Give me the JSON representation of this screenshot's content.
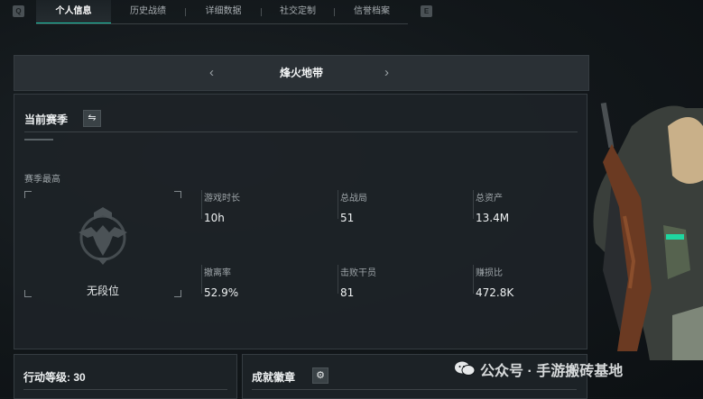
{
  "tabs": {
    "left_hint": "Q",
    "right_hint": "E",
    "items": [
      {
        "label": "个人信息",
        "active": true
      },
      {
        "label": "历史战绩",
        "active": false
      },
      {
        "label": "详细数据",
        "active": false
      },
      {
        "label": "社交定制",
        "active": false
      },
      {
        "label": "信誉档案",
        "active": false
      }
    ]
  },
  "mode": {
    "title": "烽火地带",
    "prev_icon": "chevron-left-icon",
    "next_icon": "chevron-right-icon"
  },
  "season": {
    "title": "当前赛季",
    "switch_icon": "swap-icon",
    "best_label": "赛季最高",
    "rank": "无段位",
    "rank_icon": "eagle-emblem-icon",
    "stats": [
      {
        "label": "游戏时长",
        "value": "10h"
      },
      {
        "label": "总战局",
        "value": "51"
      },
      {
        "label": "总资产",
        "value": "13.4M"
      },
      {
        "label": "撤离率",
        "value": "52.9%"
      },
      {
        "label": "击败干员",
        "value": "81"
      },
      {
        "label": "赚损比",
        "value": "472.8K"
      }
    ]
  },
  "action_level": {
    "label": "行动等级: 30"
  },
  "badges": {
    "title": "成就徽章",
    "settings_icon": "gear-icon"
  },
  "watermark": {
    "text": "公众号 · 手游搬砖基地",
    "icon": "wechat-icon"
  },
  "colors": {
    "accent": "#19c2a5",
    "background": "#12171a",
    "panel": "#1d2327"
  }
}
